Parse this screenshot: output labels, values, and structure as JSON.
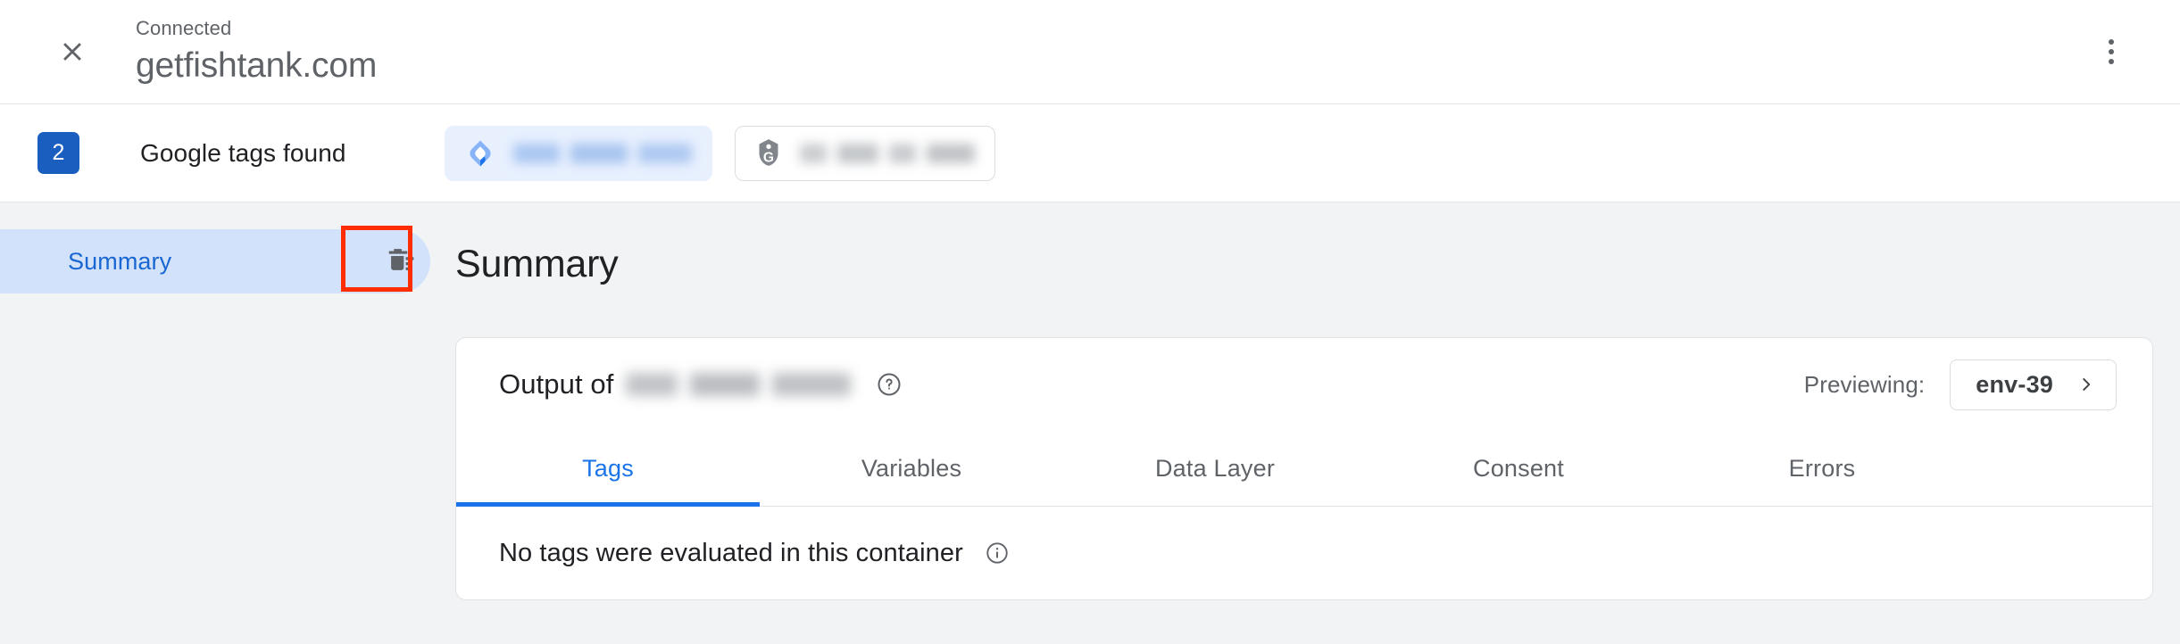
{
  "header": {
    "connected_label": "Connected",
    "domain": "getfishtank.com",
    "close_icon": "close-icon",
    "menu_icon": "more-vert-icon"
  },
  "tags_bar": {
    "count": "2",
    "label": "Google tags found",
    "chips": [
      {
        "icon": "gtm-diamond-icon",
        "label": "",
        "selected": true
      },
      {
        "icon": "google-tag-icon",
        "label": "",
        "selected": false
      }
    ]
  },
  "sidebar": {
    "items": [
      {
        "label": "Summary",
        "active": true,
        "clear_icon": "delete-sweep-icon"
      }
    ]
  },
  "main": {
    "title": "Summary",
    "card": {
      "output_of_label": "Output of",
      "output_target": "",
      "help_icon": "help-circle-icon",
      "previewing_label": "Previewing:",
      "environment": "env-39",
      "chevron_icon": "chevron-right-icon",
      "tabs": [
        {
          "label": "Tags",
          "active": true
        },
        {
          "label": "Variables",
          "active": false
        },
        {
          "label": "Data Layer",
          "active": false
        },
        {
          "label": "Consent",
          "active": false
        },
        {
          "label": "Errors",
          "active": false
        }
      ],
      "empty_message": "No tags were evaluated in this container",
      "info_icon": "info-circle-icon"
    }
  },
  "colors": {
    "accent_blue": "#1a73e8",
    "badge_blue": "#1a5fc0",
    "sidebar_active": "#d3e2fb",
    "highlight_red": "#ff2d00",
    "page_bg": "#f1f3f4"
  }
}
